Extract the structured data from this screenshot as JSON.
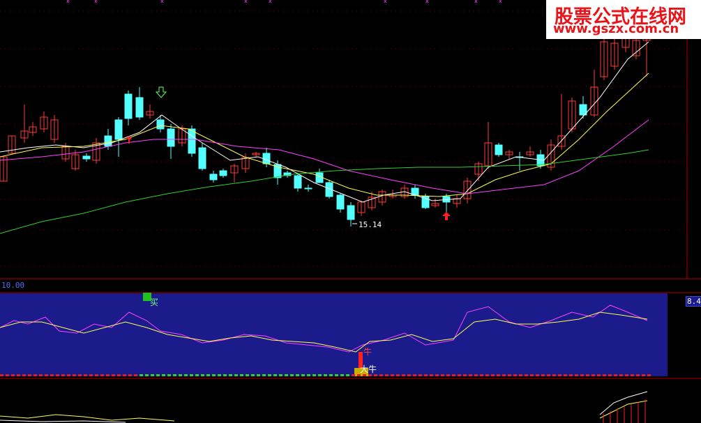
{
  "watermark": {
    "line1": "股票公式在线网",
    "line2": "www.gszx.com.cn"
  },
  "price_panel": {
    "low_label": "15.14"
  },
  "indicator_panel": {
    "top_value": "10.00",
    "right_value": "8.40",
    "buy_label": "买",
    "signal_label_1": "牛",
    "signal_label_2": "大牛"
  },
  "colors": {
    "up": "#ff3c3c",
    "down": "#54ffff",
    "ma_short": "#ffffff",
    "ma_mid": "#ffff50",
    "ma_long": "#ff40ff",
    "ma_slow": "#30d030",
    "grid": "#8b0000",
    "panel_bg": "#1b1b8c"
  },
  "icons": [
    "sell-arrow-icon",
    "buy-arrow-icon"
  ]
}
